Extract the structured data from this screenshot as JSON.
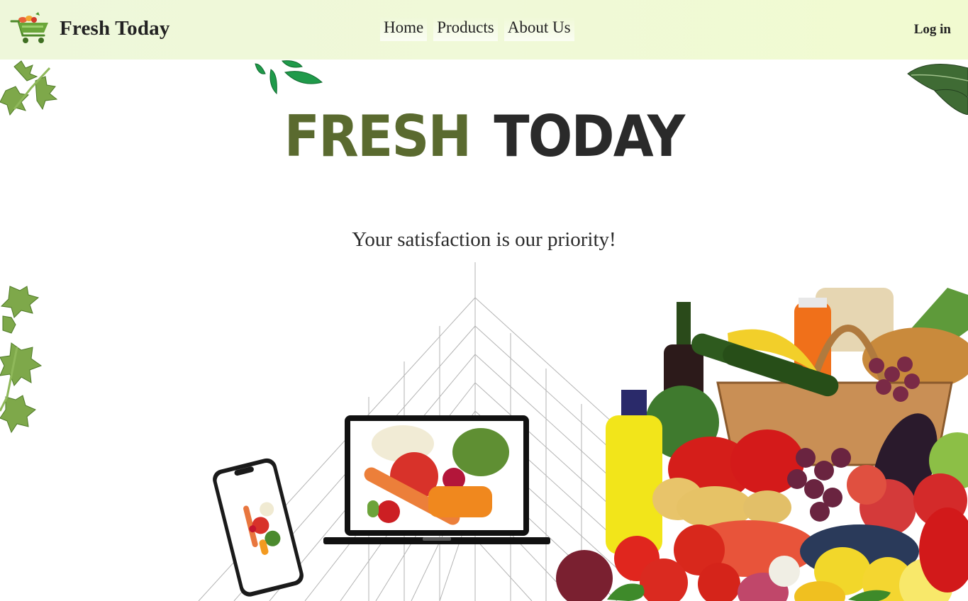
{
  "brand": {
    "name": "Fresh Today",
    "logo_icon": "shopping-cart-with-vegetables-icon"
  },
  "nav": {
    "items": [
      "Home",
      "Products",
      "About Us"
    ]
  },
  "auth": {
    "login_label": "Log in"
  },
  "hero": {
    "title_word1": "FRESH",
    "title_word2": "TODAY",
    "tagline": "Your satisfaction is our priority!"
  },
  "colors": {
    "navbar_bg": "#eff8d8",
    "title_green": "#5a6a2f",
    "title_dark": "#2a2a2a",
    "leaf_green": "#6e9a3a"
  }
}
